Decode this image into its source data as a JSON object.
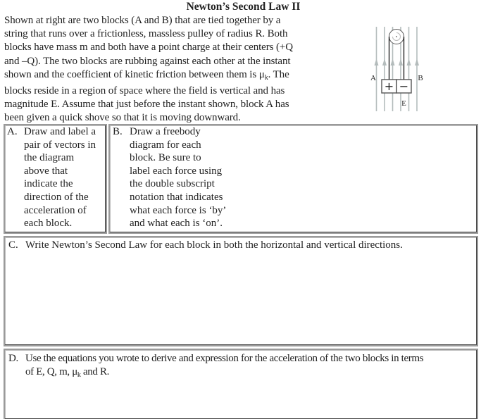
{
  "title": "Newton’s Second Law II",
  "intro": {
    "lines": [
      "Shown at right are two blocks (A and B) that are tied together by a",
      "string that runs over a frictionless, massless pulley of radius R.  Both",
      "blocks have mass m and both have a point charge at their centers (+Q",
      "and –Q).  The two blocks are rubbing against each other at the instant",
      "shown and the coefficient of kinetic friction between them is μ",
      "blocks reside in a region of space where the field is vertical and has",
      "magnitude E.  Assume that just before the instant shown, block A has",
      "been given a quick shove so that it is moving downward."
    ],
    "line5_sub": "k",
    "line5_tail": ".  The"
  },
  "diagram": {
    "label_a": "A",
    "label_b": "B",
    "label_e": "E",
    "charge_a": "+",
    "charge_b": "−",
    "field_color": "#b4bcbc"
  },
  "questions": {
    "a": {
      "letter": "A.",
      "lines": [
        "Draw and label a",
        "pair of vectors in",
        "the diagram",
        "above that",
        "indicate the",
        "direction of the",
        "acceleration of",
        "each  block."
      ]
    },
    "b": {
      "letter": "B.",
      "lines": [
        "Draw a freebody",
        "diagram for each",
        "block.  Be sure to",
        "label each force using",
        "the double subscript",
        "notation that indicates",
        "what each force is ‘by’",
        "and what each is ‘on’."
      ]
    },
    "c": {
      "letter": "C.",
      "text": "Write Newton’s Second Law for each block in both the horizontal and vertical directions."
    },
    "d": {
      "letter": "D.",
      "line1": "Use the equations you wrote to derive and expression for the acceleration of the two blocks in terms",
      "line2_pre": "of E, Q, m, μ",
      "line2_sub": "k",
      "line2_post": " and R."
    }
  }
}
